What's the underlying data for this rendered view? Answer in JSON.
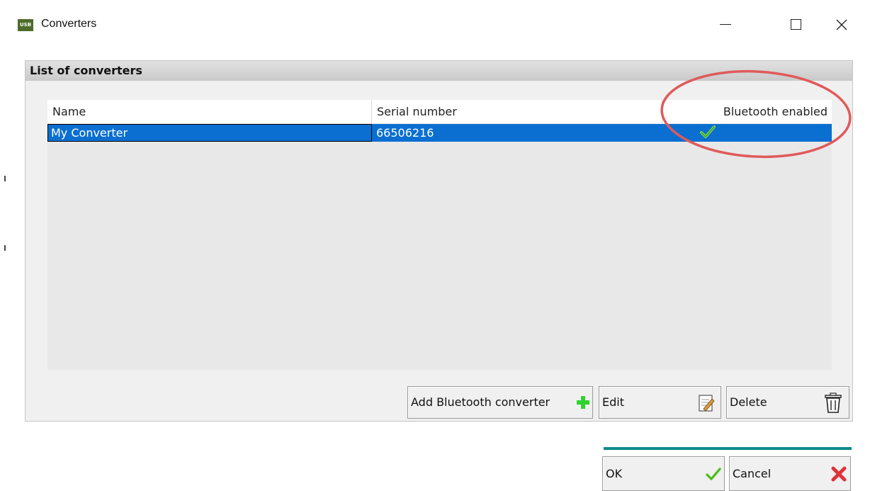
{
  "window": {
    "title": "Converters",
    "app_icon_text": "USB"
  },
  "panel": {
    "title": "List of converters"
  },
  "table": {
    "columns": [
      "Name",
      "Serial number",
      "Bluetooth enabled"
    ],
    "rows": [
      {
        "name": "My Converter",
        "serial": "66506216",
        "bluetooth_enabled": true,
        "selected": true
      }
    ]
  },
  "buttons": {
    "add_label": "Add Bluetooth converter",
    "edit_label": "Edit",
    "delete_label": "Delete",
    "ok_label": "OK",
    "cancel_label": "Cancel"
  },
  "colors": {
    "selection": "#0a6fd1",
    "annotation_circle": "#e05a5a",
    "ok_bar": "#0f8a8a",
    "check": "#5cc72a"
  }
}
